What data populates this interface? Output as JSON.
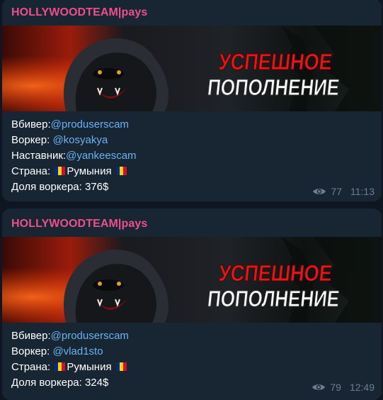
{
  "messages": [
    {
      "channel": "HOLLYWOODTEAM|pays",
      "banner_text": [
        "УСПЕШНОЕ",
        "ПОПОЛНЕНИЕ"
      ],
      "lines": [
        {
          "label": "Вбивер:",
          "value": "@produserscam"
        },
        {
          "label": "Воркер: ",
          "value": "@kosyakya"
        },
        {
          "label": "Наставник:",
          "value": "@yankeescam"
        }
      ],
      "country_label": "Страна: ",
      "country": "Румыния",
      "share": "Доля воркера: 376$",
      "views": "77",
      "time": "11:13"
    },
    {
      "channel": "HOLLYWOODTEAM|pays",
      "banner_text": [
        "УСПЕШНОЕ",
        "ПОПОЛНЕНИЕ"
      ],
      "lines": [
        {
          "label": "Вбивер:",
          "value": "@produserscam"
        },
        {
          "label": "Воркер: ",
          "value": "@vlad1sto"
        }
      ],
      "country_label": "Страна: ",
      "country": "Румыния",
      "share": "Доля воркера: 324$",
      "views": "79",
      "time": "12:49"
    }
  ],
  "colors": {
    "background": "#0e1621",
    "bubble": "#182533",
    "channel": "#ee4f8c",
    "mention": "#6ab3f3",
    "meta": "#6d7f8f",
    "flag": [
      "#002b7f",
      "#fcd116",
      "#ce1126"
    ]
  },
  "icons": {
    "views": "eye-icon",
    "flag": "romania-flag-icon"
  }
}
